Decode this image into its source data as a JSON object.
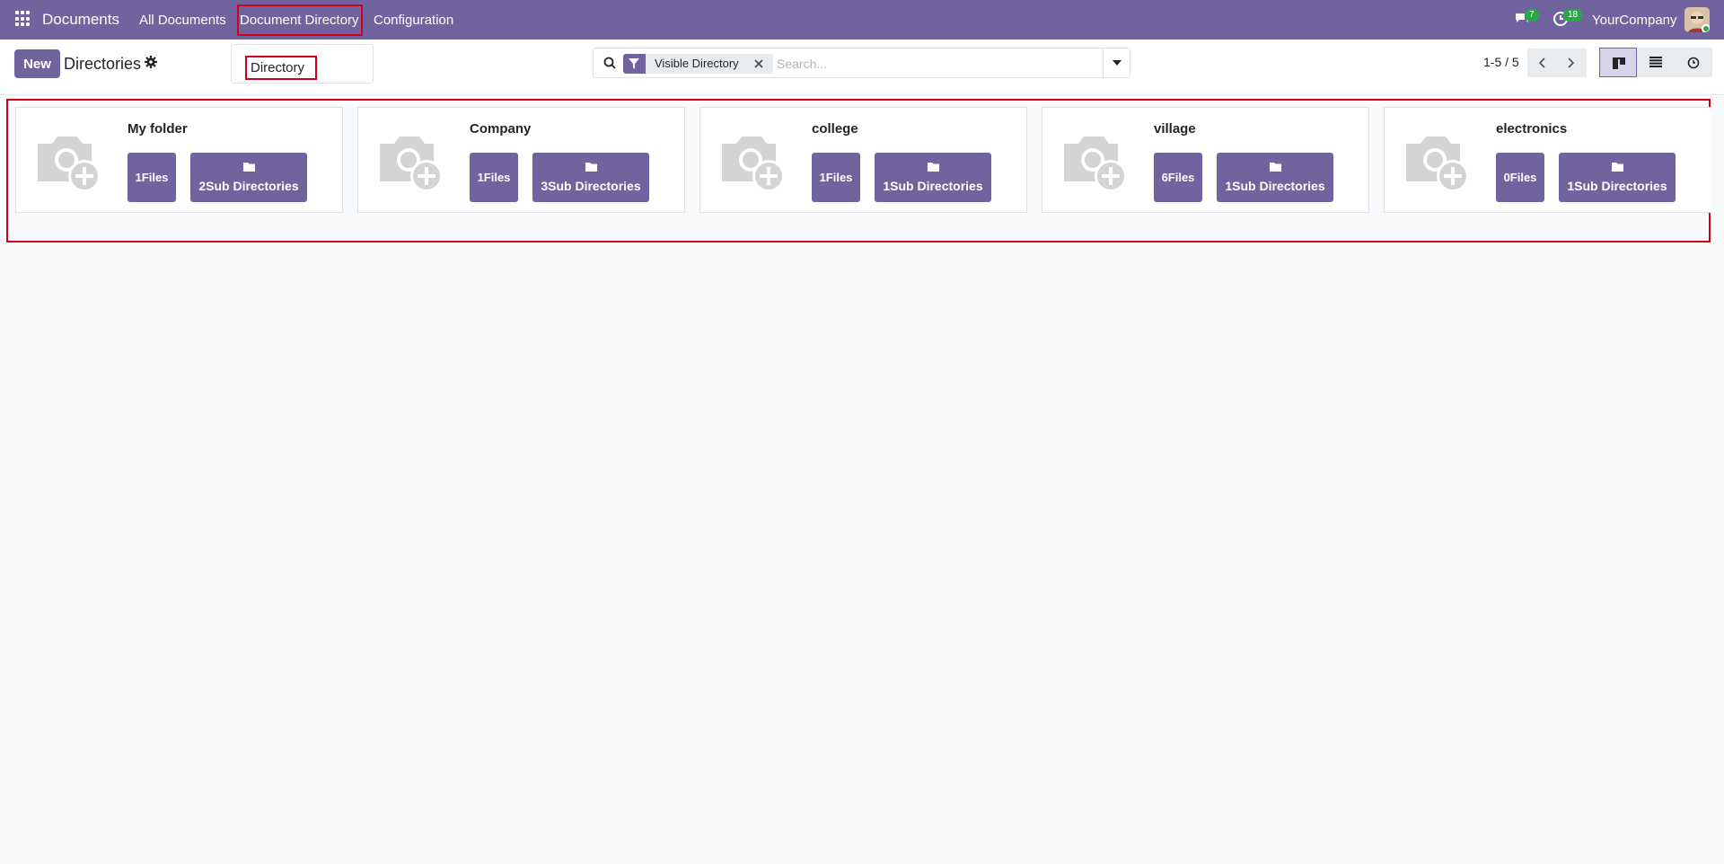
{
  "app": {
    "brand": "Documents",
    "nav": [
      "All Documents",
      "Document Directory",
      "Configuration"
    ],
    "messages_count": "7",
    "activities_count": "18",
    "company": "YourCompany"
  },
  "control": {
    "new_label": "New",
    "title": "Directories",
    "dropdown_item": "Directory",
    "facet": "Visible Directory",
    "search_placeholder": "Search...",
    "pager": "1-5 / 5"
  },
  "cards": [
    {
      "name": "My folder",
      "files": "1Files",
      "subdirs": "2Sub Directories"
    },
    {
      "name": "Company",
      "files": "1Files",
      "subdirs": "3Sub Directories"
    },
    {
      "name": "college",
      "files": "1Files",
      "subdirs": "1Sub Directories"
    },
    {
      "name": "village",
      "files": "6Files",
      "subdirs": "1Sub Directories"
    },
    {
      "name": "electronics",
      "files": "0Files",
      "subdirs": "1Sub Directories"
    }
  ],
  "colors": {
    "primary": "#71639e",
    "highlight": "#d0021b",
    "badge": "#28a745"
  }
}
